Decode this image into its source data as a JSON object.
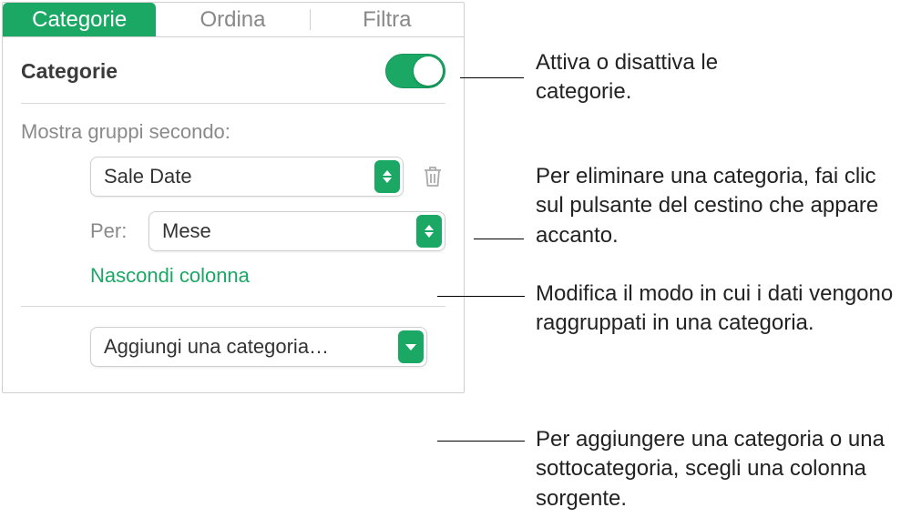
{
  "tabs": {
    "categorie": "Categorie",
    "ordina": "Ordina",
    "filtra": "Filtra"
  },
  "section": {
    "title": "Categorie",
    "group_by_label": "Mostra gruppi secondo:",
    "group_by_value": "Sale Date",
    "per_label": "Per:",
    "per_value": "Mese",
    "hide_column": "Nascondi colonna",
    "add_category": "Aggiungi una categoria…"
  },
  "callouts": {
    "toggle": "Attiva o disattiva le categorie.",
    "delete": "Per eliminare una categoria, fai clic sul pulsante del cestino che appare accanto.",
    "modify": "Modifica il modo in cui i dati vengono raggruppati in una categoria.",
    "add": "Per aggiungere una categoria o una sottocategoria, scegli una colonna sorgente."
  }
}
